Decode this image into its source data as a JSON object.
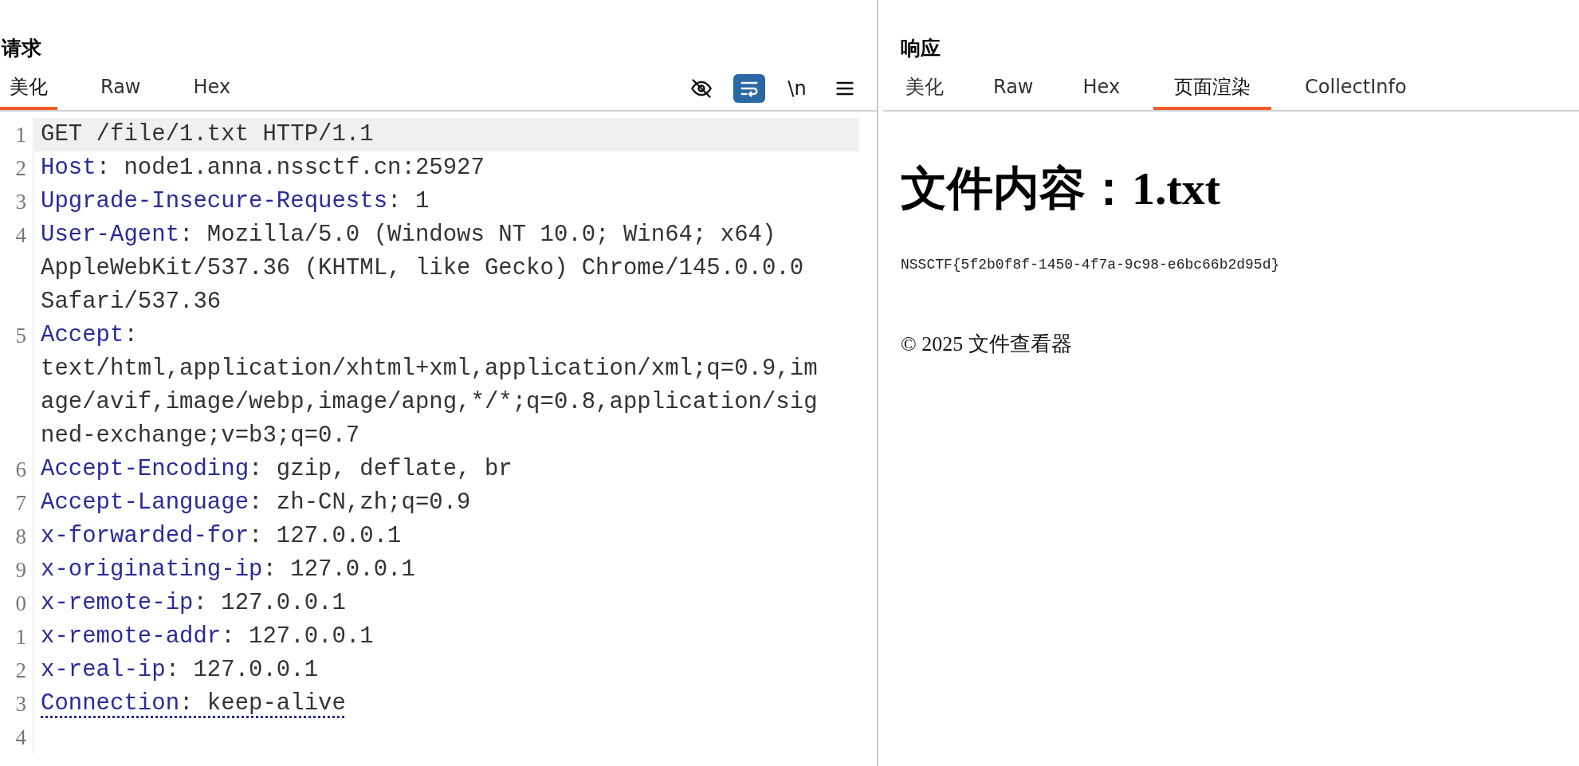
{
  "request": {
    "title": "请求",
    "tabs": [
      {
        "label": "美化",
        "selected": true
      },
      {
        "label": "Raw",
        "selected": false
      },
      {
        "label": "Hex",
        "selected": false
      }
    ],
    "toolbar": [
      {
        "kind": "hide",
        "on": false
      },
      {
        "kind": "wrap",
        "on": true
      },
      {
        "kind": "newline",
        "label": "\\n",
        "on": false
      },
      {
        "kind": "menu"
      }
    ],
    "lines": [
      {
        "number": "1",
        "kind": "request_line",
        "value": "GET /file/1.txt HTTP/1.1",
        "current": true
      },
      {
        "number": "2",
        "kind": "header",
        "name": "Host",
        "value": ": node1.anna.nssctf.cn:25927",
        "current": false
      },
      {
        "number": "3",
        "kind": "header",
        "name": "Upgrade-Insecure-Requests",
        "value": ": 1",
        "current": false
      },
      {
        "number": "4",
        "kind": "header",
        "name": "User-Agent",
        "value": ": Mozilla/5.0 (Windows NT 10.0; Win64; x64)",
        "continuation": [
          "AppleWebKit/537.36 (KHTML, like Gecko) Chrome/145.0.0.0",
          "Safari/537.36"
        ],
        "current": false
      },
      {
        "number": "5",
        "kind": "header",
        "name": "Accept",
        "value": ":",
        "continuation": [
          "text/html,application/xhtml+xml,application/xml;q=0.9,im",
          "age/avif,image/webp,image/apng,*/*;q=0.8,application/sig",
          "ned-exchange;v=b3;q=0.7"
        ],
        "current": false
      },
      {
        "number": "6",
        "kind": "header",
        "name": "Accept-Encoding",
        "value": ": gzip, deflate, br",
        "current": false
      },
      {
        "number": "7",
        "kind": "header",
        "name": "Accept-Language",
        "value": ": zh-CN,zh;q=0.9",
        "current": false
      },
      {
        "number": "8",
        "kind": "header",
        "name": "x-forwarded-for",
        "value": ": 127.0.0.1",
        "current": false
      },
      {
        "number": "9",
        "kind": "header",
        "name": "x-originating-ip",
        "value": ": 127.0.0.1",
        "current": false
      },
      {
        "number": "0",
        "kind": "header",
        "name": "x-remote-ip",
        "value": ": 127.0.0.1",
        "current": false
      },
      {
        "number": "1",
        "kind": "header",
        "name": "x-remote-addr",
        "value": ": 127.0.0.1",
        "current": false
      },
      {
        "number": "2",
        "kind": "header",
        "name": "x-real-ip",
        "value": ": 127.0.0.1",
        "current": false
      },
      {
        "number": "3",
        "kind": "header",
        "name": "Connection",
        "value": ": keep-alive",
        "underlined": true,
        "current": false
      },
      {
        "number": "4",
        "kind": "empty",
        "current": false
      }
    ]
  },
  "response": {
    "title": "响应",
    "tabs": [
      {
        "label": "美化",
        "selected": false
      },
      {
        "label": "Raw",
        "selected": false
      },
      {
        "label": "Hex",
        "selected": false
      },
      {
        "label": "页面渲染",
        "selected": true
      },
      {
        "label": "CollectInfo",
        "selected": false
      }
    ],
    "rendered": {
      "heading": "文件内容：1.txt",
      "content": "NSSCTF{5f2b0f8f-1450-4f7a-9c98-e6bc66b2d95d}",
      "footer": "© 2025 文件查看器"
    }
  }
}
